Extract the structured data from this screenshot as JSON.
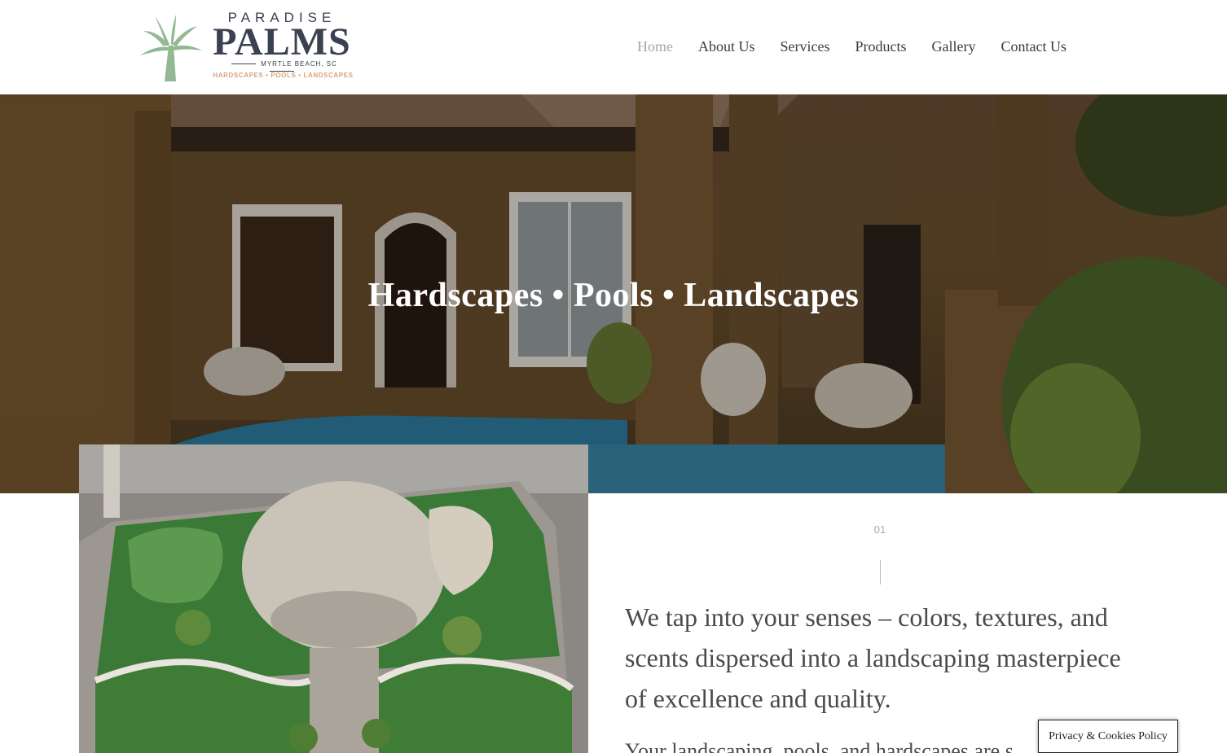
{
  "header": {
    "logo": {
      "paradise": "PARADISE",
      "palms": "PALMS",
      "location": "MYRTLE BEACH, SC",
      "tagline": "HARDSCAPES • POOLS • LANDSCAPES"
    },
    "nav": [
      {
        "label": "Home",
        "active": true
      },
      {
        "label": "About Us",
        "active": false
      },
      {
        "label": "Services",
        "active": false
      },
      {
        "label": "Products",
        "active": false
      },
      {
        "label": "Gallery",
        "active": false
      },
      {
        "label": "Contact Us",
        "active": false
      }
    ]
  },
  "hero": {
    "title": "Hardscapes • Pools • Landscapes"
  },
  "content": {
    "counter": "01",
    "lead": "We tap into your senses – colors, textures, and scents dispersed into a landscaping masterpiece of excellence and quality.",
    "body": "Your landscaping, pools, and hardscapes are s"
  },
  "privacy": {
    "label": "Privacy & Cookies Policy"
  },
  "colors": {
    "nav_active": "#a7a7a7",
    "brand_dark": "#3a4150",
    "brand_tan": "#d9a27d",
    "palm_green": "#8fb58f"
  }
}
